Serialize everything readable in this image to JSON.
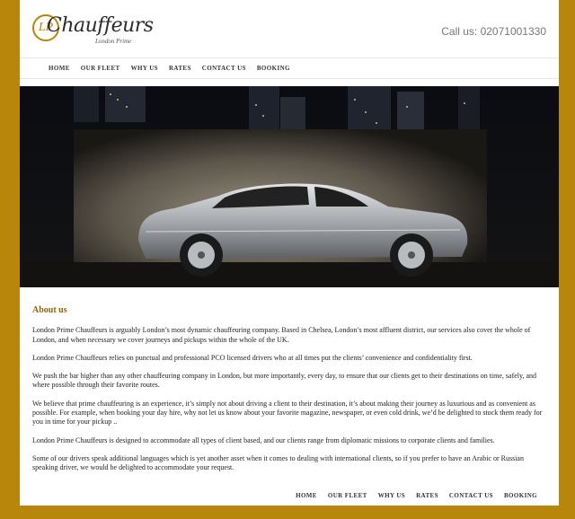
{
  "header": {
    "logo_monogram": "LP",
    "logo_text": "Chauffeurs",
    "logo_subtitle": "London Prime",
    "phone": "Call us: 02071001330"
  },
  "nav": {
    "items": [
      "HOME",
      "OUR FLEET",
      "WHY US",
      "RATES",
      "CONTACT US",
      "BOOKING"
    ]
  },
  "about": {
    "heading": "About us",
    "paragraphs": [
      "London Prime Chauffeurs is arguably London’s most dynamic chauffeuring company.   Based in Chelsea, London’s most affluent district, our services also cover the whole of London, and when necessary we cover journeys and pickups within the whole of the UK.",
      "London Prime Chauffeurs relies on punctual and professional PCO licensed drivers who at all times put the clients’ convenience and confidentiality first.",
      "We push the bar higher than any other chauffeuring company in London, but more importantly, every day, to ensure that our clients get to their destinations on time, safely, and where possible through their favorite routes.",
      "We believe that prime chauffeuring is an experience, it’s simply not about driving a client to their destination, it’s about making their journey as luxurious and as convenient as possible.  For example, when booking your day hire, why not let us know about your favorite magazine, newspaper, or even cold drink, we’d be delighted to stock them ready for you in time for your pickup ..",
      "London Prime Chauffeurs is designed to accommodate all types of client based, and our clients range from diplomatic missions to corporate clients and families.",
      "Some of our drivers speak additional languages which is yet another asset when it comes to dealing with international clients, so if you prefer to have an Arabic or Russian speaking driver, we would be delighted to accommodate your request."
    ]
  },
  "footer_nav": {
    "items": [
      "HOME",
      "OUR FLEET",
      "WHY US",
      "RATES",
      "CONTACT US",
      "BOOKING"
    ]
  },
  "colors": {
    "frame": "#b8860b",
    "heading": "#8b6508"
  },
  "hero": {
    "image": "silver-sedan-night-city-photo"
  }
}
